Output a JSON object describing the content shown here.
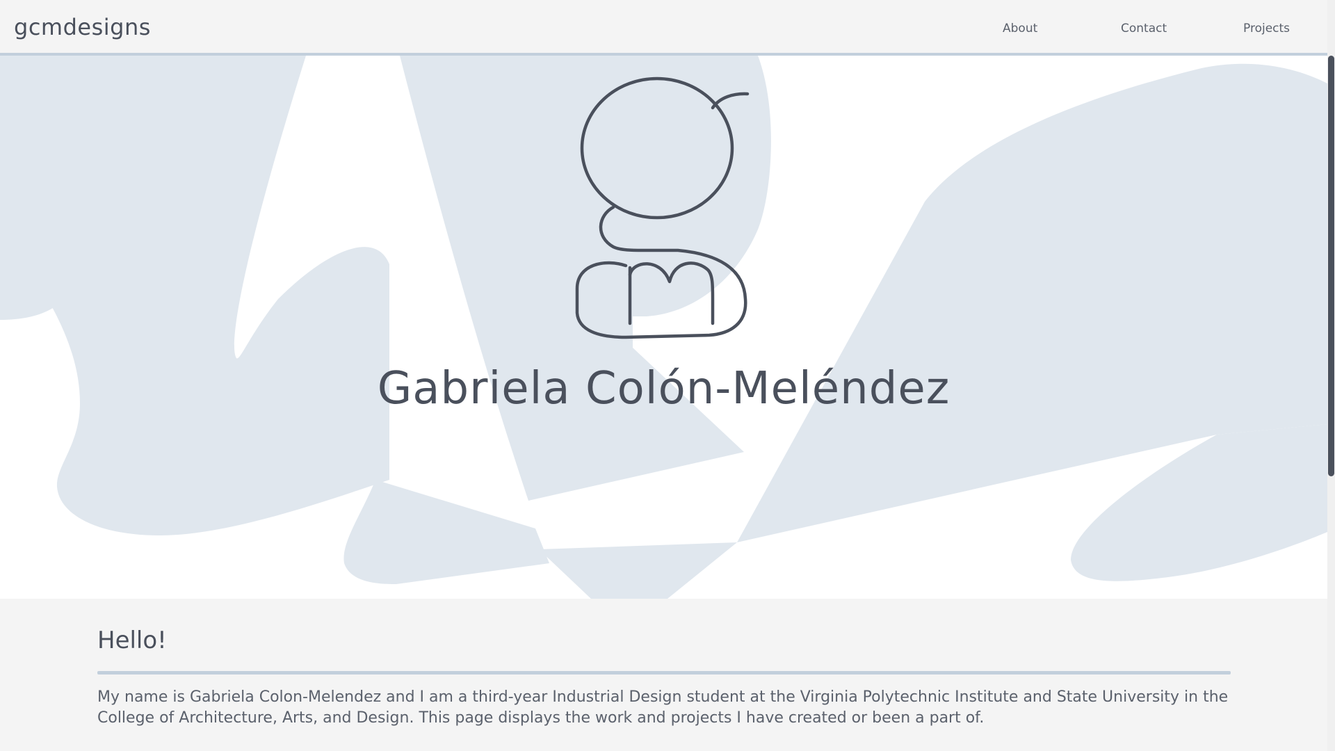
{
  "nav": {
    "brand": "gcmdesigns",
    "links": [
      {
        "label": "About"
      },
      {
        "label": "Contact"
      },
      {
        "label": "Projects"
      }
    ]
  },
  "hero": {
    "logo_icon": "gcm-monogram-logo",
    "name": "Gabriela Colón-Meléndez"
  },
  "about": {
    "title": "Hello!",
    "body": "My name is Gabriela Colon-Melendez and I am a third-year Industrial Design student at the Virginia Polytechnic Institute and State University in the College of Architecture, Arts, and Design. This page displays the work and projects I have created or been a part of."
  },
  "colors": {
    "text": "#4a505c",
    "accent_rule": "#c2cfdc",
    "hero_shapes": "#e0e7ee",
    "page_bg": "#f4f4f4"
  }
}
